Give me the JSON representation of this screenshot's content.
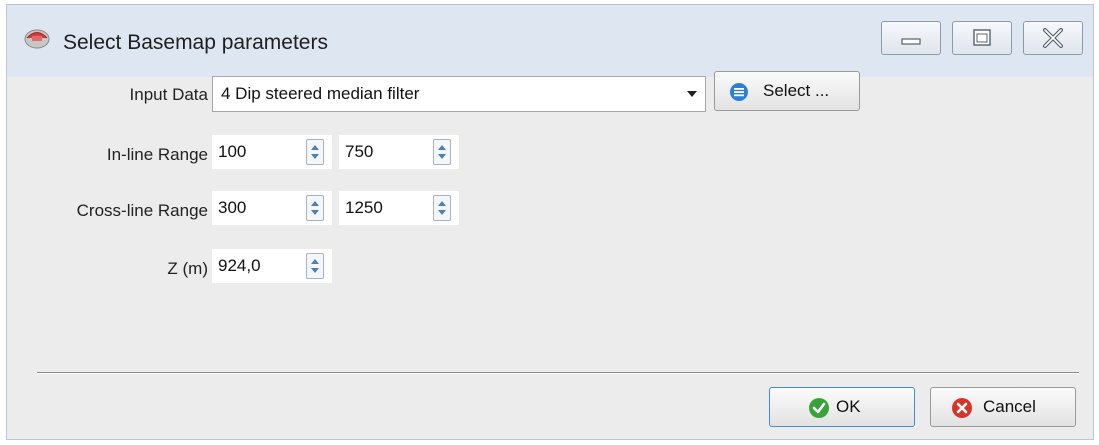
{
  "window": {
    "title": "Select Basemap parameters",
    "app_icon": "app-logo-icon",
    "controls": [
      "minimize-icon",
      "maximize-icon",
      "close-icon"
    ]
  },
  "form": {
    "input_data": {
      "label": "Input Data",
      "value": "4 Dip steered median filter",
      "select_button": "Select ..."
    },
    "inline_range": {
      "label": "In-line Range",
      "from": "100",
      "to": "750"
    },
    "crossline_range": {
      "label": "Cross-line Range",
      "from": "300",
      "to": "1250"
    },
    "z": {
      "label": "Z  (m)",
      "value": "924,0"
    }
  },
  "buttons": {
    "ok": "OK",
    "cancel": "Cancel"
  },
  "colors": {
    "titlebar": "#dde6f1",
    "dialog_bg": "#ececec",
    "ok_icon": "#3aa23a",
    "cancel_icon": "#d9342b",
    "select_icon": "#2b7fd6"
  }
}
